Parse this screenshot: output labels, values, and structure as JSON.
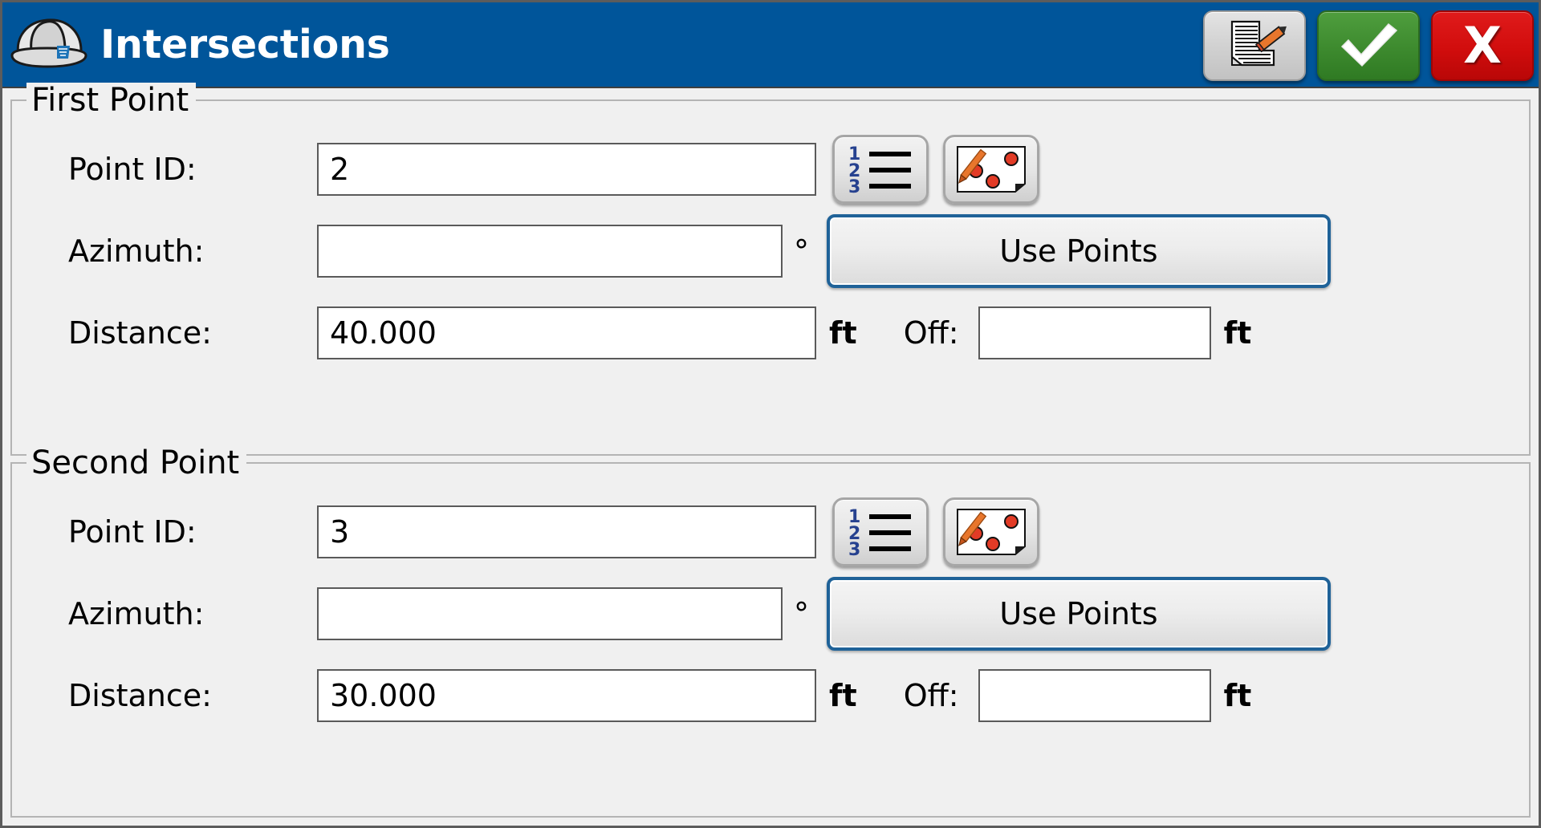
{
  "window": {
    "title": "Intersections",
    "accent_blue": "#00559A",
    "background": "#F0F0F0",
    "ok_green": "#3D8A2E",
    "cancel_red": "#D10D0D",
    "focus_border_blue": "#1F6298"
  },
  "titlebar": {
    "app_icon": "hard-hat-icon",
    "title": "Intersections",
    "buttons": [
      {
        "name": "notes-button",
        "icon": "document-pencil-icon",
        "label": ""
      },
      {
        "name": "accept-button",
        "icon": "checkmark-icon",
        "label": ""
      },
      {
        "name": "cancel-button",
        "icon": "x-icon",
        "label": "X"
      }
    ]
  },
  "groups": [
    {
      "legend": "First Point",
      "rows": {
        "point_id": {
          "label": "Point ID:",
          "value": "2",
          "placeholder": "",
          "list_button_icon": "numbered-list-icon",
          "map_button_icon": "map-pick-point-icon"
        },
        "azimuth": {
          "label": "Azimuth:",
          "value": "",
          "placeholder": "",
          "unit": "°",
          "use_points_label": "Use Points"
        },
        "distance": {
          "label": "Distance:",
          "value": "40.000",
          "placeholder": "",
          "unit": "ft",
          "offset_label": "Off:",
          "offset_value": "",
          "offset_unit": "ft"
        }
      }
    },
    {
      "legend": "Second Point",
      "rows": {
        "point_id": {
          "label": "Point ID:",
          "value": "3",
          "placeholder": "",
          "list_button_icon": "numbered-list-icon",
          "map_button_icon": "map-pick-point-icon"
        },
        "azimuth": {
          "label": "Azimuth:",
          "value": "",
          "placeholder": "",
          "unit": "°",
          "use_points_label": "Use Points"
        },
        "distance": {
          "label": "Distance:",
          "value": "30.000",
          "placeholder": "",
          "unit": "ft",
          "offset_label": "Off:",
          "offset_value": "",
          "offset_unit": "ft"
        }
      }
    }
  ],
  "icons": {
    "numbered_list_digits": [
      "1",
      "2",
      "3"
    ]
  }
}
